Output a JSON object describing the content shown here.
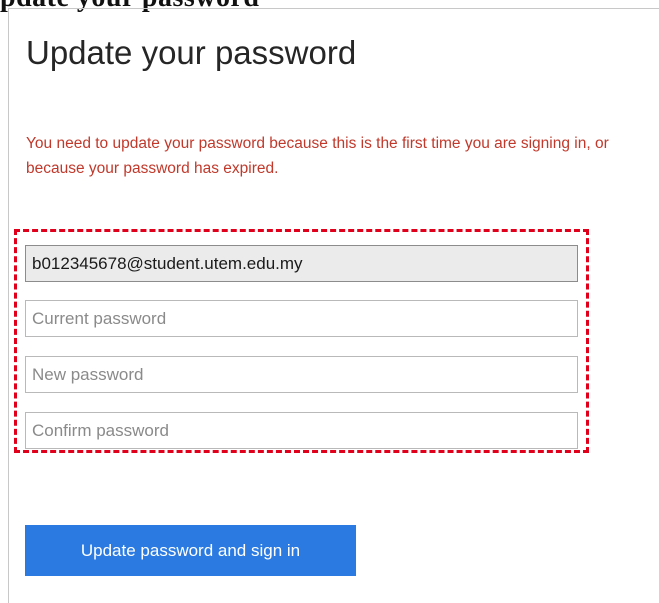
{
  "header_fragment": "pdate your password",
  "form": {
    "title": "Update your password",
    "message": "You need to update your password because this is the first time you are signing in, or because your password has expired.",
    "username_value": "b012345678@student.utem.edu.my",
    "current_password_placeholder": "Current password",
    "new_password_placeholder": "New password",
    "confirm_password_placeholder": "Confirm password",
    "submit_label": "Update password and sign in"
  },
  "colors": {
    "message_text": "#c0392b",
    "highlight_border": "#e0001b",
    "button_background": "#2a7ae2",
    "readonly_field_background": "#ebebeb"
  }
}
